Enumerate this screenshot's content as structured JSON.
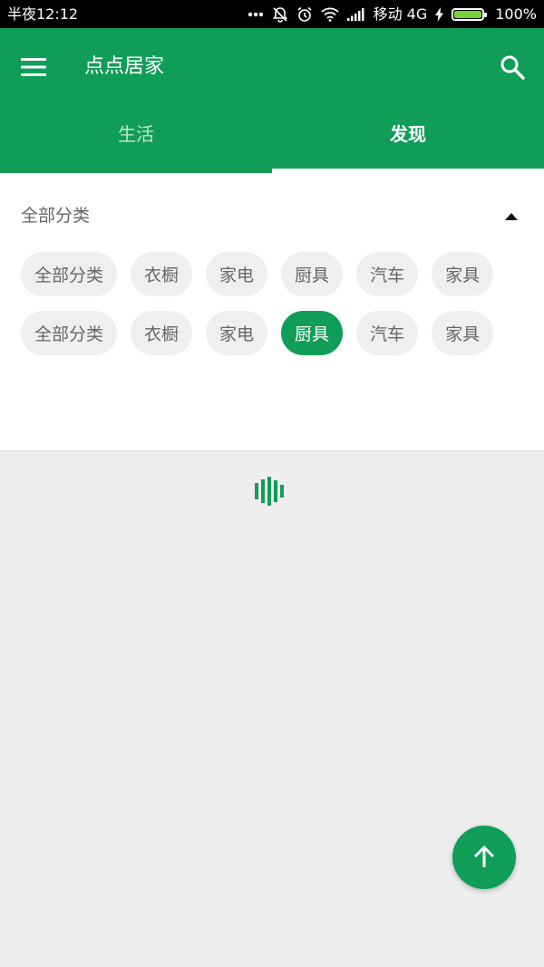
{
  "status_bar": {
    "time": "半夜12:12",
    "carrier": "移动 4G",
    "battery": "100%",
    "icons": [
      "more-dots-icon",
      "bell-off-icon",
      "alarm-icon",
      "wifi-icon",
      "signal-icon",
      "charging-icon",
      "battery-icon"
    ]
  },
  "app_bar": {
    "title": "点点居家",
    "icons": [
      "menu-icon",
      "search-icon"
    ]
  },
  "tabs": [
    {
      "label": "生活",
      "active": false
    },
    {
      "label": "发现",
      "active": true
    }
  ],
  "category": {
    "header": "全部分类",
    "chips": [
      {
        "label": "全部分类",
        "selected": false
      },
      {
        "label": "衣橱",
        "selected": false
      },
      {
        "label": "家电",
        "selected": false
      },
      {
        "label": "厨具",
        "selected": false
      },
      {
        "label": "汽车",
        "selected": false
      },
      {
        "label": "家具",
        "selected": false
      },
      {
        "label": "全部分类",
        "selected": false
      },
      {
        "label": "衣橱",
        "selected": false
      },
      {
        "label": "家电",
        "selected": false
      },
      {
        "label": "厨具",
        "selected": true
      },
      {
        "label": "汽车",
        "selected": false
      },
      {
        "label": "家具",
        "selected": false
      }
    ]
  },
  "colors": {
    "primary": "#0f9d58",
    "chip_bg": "#efefef",
    "chip_text": "#666666",
    "background": "#eeeeee"
  }
}
